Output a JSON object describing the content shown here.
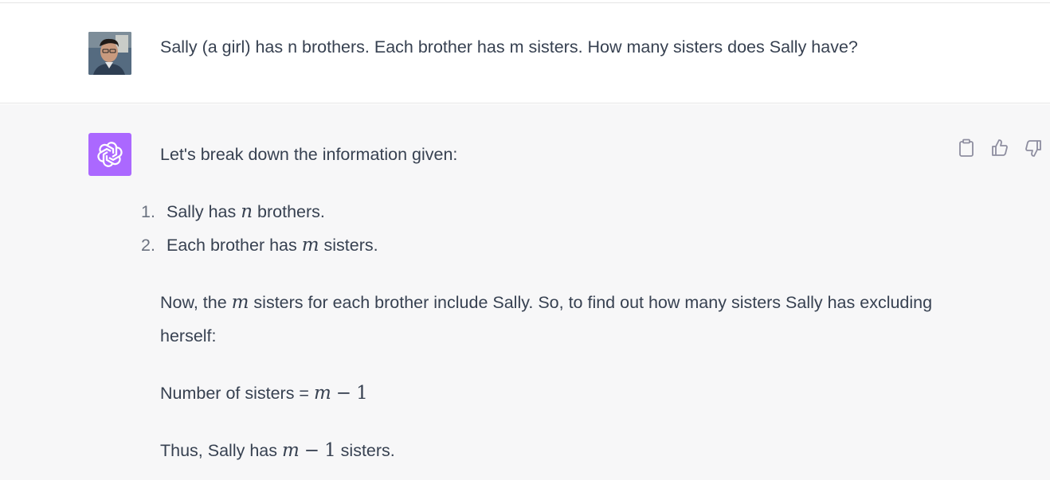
{
  "user_message": {
    "text": "Sally (a girl) has n brothers. Each brother has m sisters. How many sisters does Sally have?",
    "avatar_icon": "user-photo-avatar"
  },
  "assistant_message": {
    "avatar_icon": "openai-logo-icon",
    "avatar_color": "#ab68ff",
    "intro": "Let's break down the information given:",
    "list": [
      {
        "num": "1.",
        "pre": "Sally has ",
        "var": "n",
        "post": " brothers."
      },
      {
        "num": "2.",
        "pre": "Each brother has ",
        "var": "m",
        "post": " sisters."
      }
    ],
    "paragraph2": {
      "pre": "Now, the ",
      "var": "m",
      "post": " sisters for each brother include Sally. So, to find out how many sisters Sally has excluding herself:"
    },
    "formula": {
      "label": "Number of sisters = ",
      "var": "m",
      "op": "−",
      "num": "1"
    },
    "conclusion": {
      "pre": "Thus, Sally has ",
      "var": "m",
      "op": "−",
      "num": "1",
      "post": " sisters."
    },
    "actions": [
      {
        "name": "copy-icon"
      },
      {
        "name": "thumbs-up-icon"
      },
      {
        "name": "thumbs-down-icon"
      }
    ]
  },
  "colors": {
    "assistant_bg": "#f7f7f8",
    "text": "#374151",
    "icon_gray": "#8e8ea0"
  }
}
